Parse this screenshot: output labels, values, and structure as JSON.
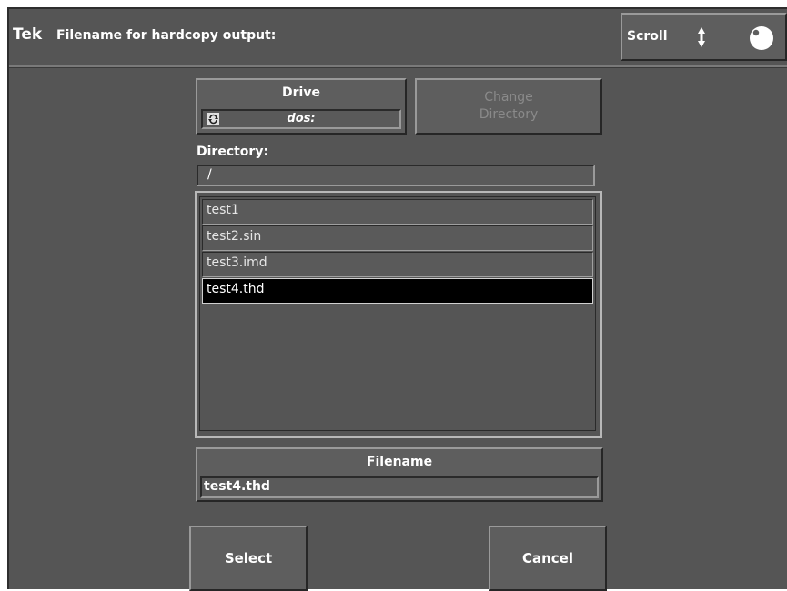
{
  "header": {
    "logo": "Tek",
    "title": "Filename for hardcopy output:",
    "scroll_control": {
      "label": "Scroll",
      "arrows_icon": "up-down-arrows-icon",
      "knob_icon": "knob-icon"
    }
  },
  "drive": {
    "label": "Drive",
    "value": "dos:",
    "cycle_icon": "cycle-icon"
  },
  "change_directory": {
    "label_line1": "Change",
    "label_line2": "Directory",
    "enabled": false
  },
  "directory": {
    "label": "Directory:",
    "value": "/"
  },
  "files": {
    "items": [
      {
        "name": "test1",
        "selected": false
      },
      {
        "name": "test2.sin",
        "selected": false
      },
      {
        "name": "test3.imd",
        "selected": false
      },
      {
        "name": "test4.thd",
        "selected": true
      }
    ]
  },
  "filename": {
    "label": "Filename",
    "value": "test4.thd"
  },
  "buttons": {
    "select": "Select",
    "cancel": "Cancel"
  },
  "colors": {
    "background": "#555555",
    "selected_row": "#000000",
    "text": "#ffffff",
    "disabled_text": "#8a8a8a"
  }
}
